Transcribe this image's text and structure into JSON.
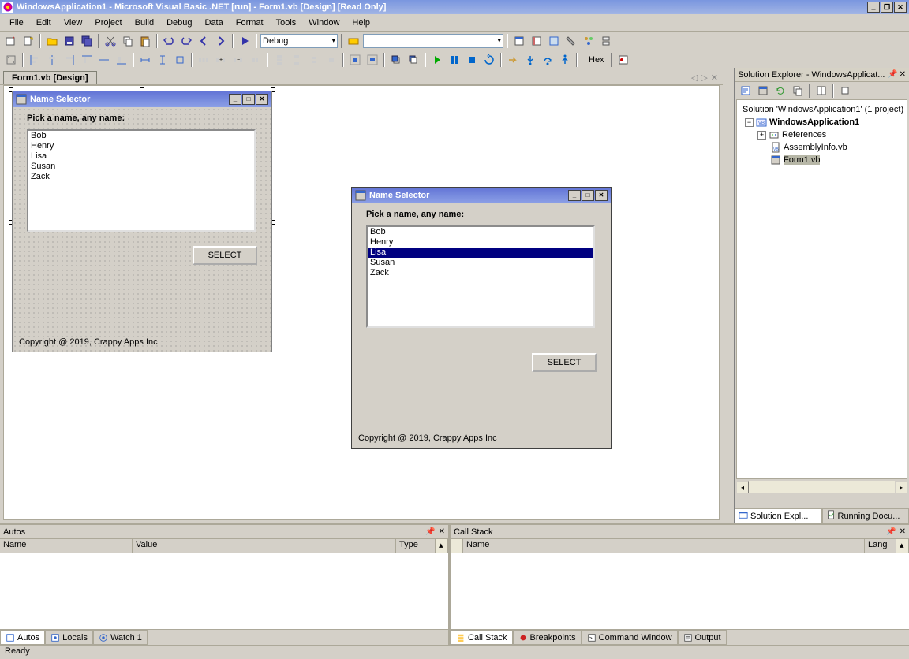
{
  "titlebar": {
    "caption": "WindowsApplication1 - Microsoft Visual Basic .NET [run] - Form1.vb [Design] [Read Only]"
  },
  "menu": [
    "File",
    "Edit",
    "View",
    "Project",
    "Build",
    "Debug",
    "Data",
    "Format",
    "Tools",
    "Window",
    "Help"
  ],
  "toolbar": {
    "config": "Debug",
    "hex": "Hex"
  },
  "doc_tab": "Form1.vb [Design]",
  "designer_form": {
    "title": "Name Selector",
    "prompt": "Pick a name, any name:",
    "names": [
      "Bob",
      "Henry",
      "Lisa",
      "Susan",
      "Zack"
    ],
    "select_label": "SELECT",
    "copyright": "Copyright @ 2019, Crappy Apps Inc"
  },
  "runtime_form": {
    "title": "Name Selector",
    "prompt": "Pick a name, any name:",
    "names": [
      "Bob",
      "Henry",
      "Lisa",
      "Susan",
      "Zack"
    ],
    "selected_index": 2,
    "select_label": "SELECT",
    "copyright": "Copyright @ 2019, Crappy Apps Inc"
  },
  "solution_explorer": {
    "title": "Solution Explorer - WindowsApplicat...",
    "solution": "Solution 'WindowsApplication1' (1 project)",
    "project": "WindowsApplication1",
    "nodes": [
      "References",
      "AssemblyInfo.vb",
      "Form1.vb"
    ],
    "tabs": [
      "Solution Expl...",
      "Running Docu..."
    ]
  },
  "autos": {
    "title": "Autos",
    "cols": [
      "Name",
      "Value",
      "Type"
    ],
    "tabs": [
      "Autos",
      "Locals",
      "Watch 1"
    ]
  },
  "callstack": {
    "title": "Call Stack",
    "cols": [
      "Name",
      "Lang"
    ],
    "tabs": [
      "Call Stack",
      "Breakpoints",
      "Command Window",
      "Output"
    ]
  },
  "status": "Ready"
}
